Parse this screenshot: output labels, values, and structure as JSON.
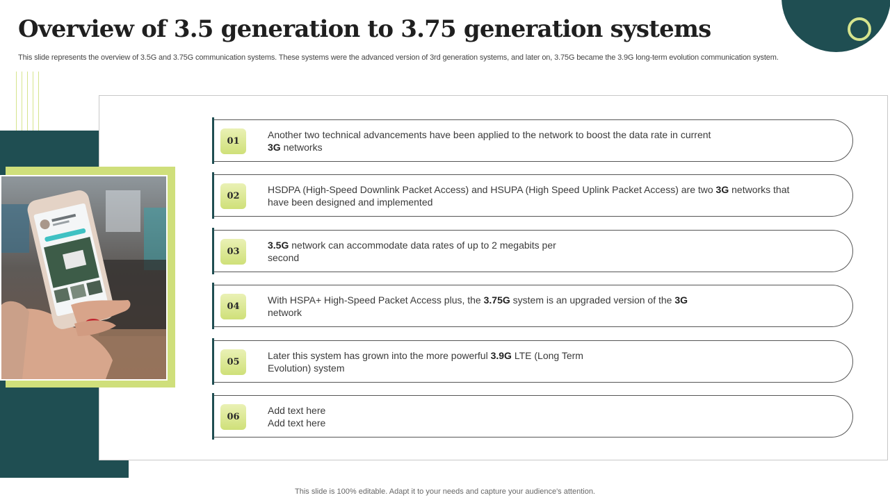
{
  "slide": {
    "title": "Overview of 3.5 generation to 3.75 generation systems",
    "subtitle": "This slide represents the overview of 3.5G and 3.75G communication systems. These systems were the advanced version of 3rd generation systems, and later on, 3.75G became the 3.9G long-term evolution communication system.",
    "footer": "This slide is 100% editable. Adapt it to your needs and capture your audience's attention."
  },
  "colors": {
    "teal": "#1f4e52",
    "lime": "#cfdf7b",
    "badge_gradient_top": "#eaf1b5",
    "badge_gradient_bottom": "#cfe079"
  },
  "image": {
    "icon": "smartphone-in-hand-photo"
  },
  "items": [
    {
      "number": "01",
      "line1_parts": [
        "Another two technical advancements have been applied to the network to boost the data rate in current"
      ],
      "line1_bold": [],
      "line2_parts": [
        "",
        " networks"
      ],
      "line2_bold": [
        "3G"
      ]
    },
    {
      "number": "02",
      "line1_parts": [
        "HSDPA (High-Speed Downlink Packet Access) and HSUPA (High Speed Uplink Packet Access) are two ",
        " networks that"
      ],
      "line1_bold": [
        "3G"
      ],
      "line2_parts": [
        "have been designed and implemented"
      ],
      "line2_bold": []
    },
    {
      "number": "03",
      "line1_parts": [
        "",
        " network can accommodate data rates of up to 2 megabits per"
      ],
      "line1_bold": [
        "3.5G"
      ],
      "line2_parts": [
        "second"
      ],
      "line2_bold": []
    },
    {
      "number": "04",
      "line1_parts": [
        "With HSPA+ High-Speed Packet Access plus, the ",
        " system is an upgraded version of the ",
        ""
      ],
      "line1_bold": [
        "3.75G",
        "3G"
      ],
      "line2_parts": [
        "network"
      ],
      "line2_bold": []
    },
    {
      "number": "05",
      "line1_parts": [
        "Later this system has grown into the more powerful ",
        " LTE (Long Term"
      ],
      "line1_bold": [
        "3.9G"
      ],
      "line2_parts": [
        "Evolution) system"
      ],
      "line2_bold": []
    },
    {
      "number": "06",
      "line1_parts": [
        "Add text here"
      ],
      "line1_bold": [],
      "line2_parts": [
        "Add text here"
      ],
      "line2_bold": []
    }
  ]
}
